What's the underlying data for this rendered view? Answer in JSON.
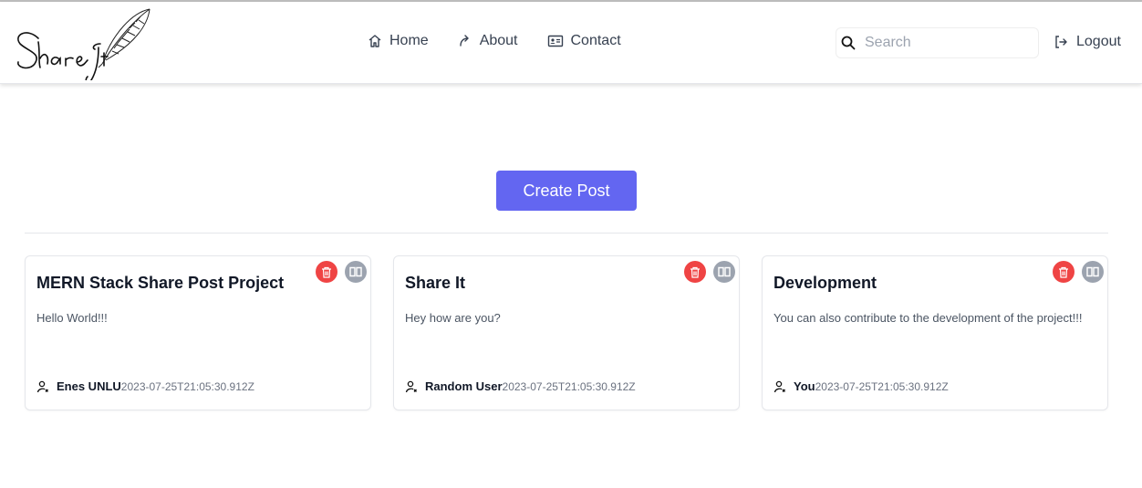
{
  "header": {
    "logo_text": "Share It",
    "nav": [
      {
        "label": "Home",
        "icon": "home-icon"
      },
      {
        "label": "About",
        "icon": "share-arrow-icon"
      },
      {
        "label": "Contact",
        "icon": "contact-card-icon"
      }
    ],
    "search": {
      "placeholder": "Search",
      "value": ""
    },
    "logout_label": "Logout"
  },
  "main": {
    "create_label": "Create Post"
  },
  "posts": [
    {
      "title": "MERN Stack Share Post Project",
      "body": "Hello World!!!",
      "author": "Enes UNLU",
      "time": "2023-07-25T21:05:30.912Z"
    },
    {
      "title": "Share It",
      "body": "Hey how are you?",
      "author": "Random User",
      "time": "2023-07-25T21:05:30.912Z"
    },
    {
      "title": "Development",
      "body": "You can also contribute to the development of the project!!!",
      "author": "You",
      "time": "2023-07-25T21:05:30.912Z"
    }
  ],
  "colors": {
    "accent": "#6366f1",
    "delete": "#ef4444",
    "edit": "#9ca3af"
  }
}
